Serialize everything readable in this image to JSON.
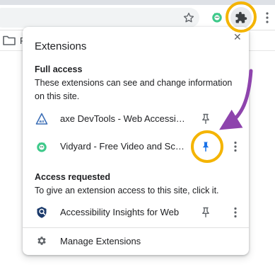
{
  "bookmarks_bar": {
    "folder_label": "F"
  },
  "popup": {
    "title": "Extensions",
    "full_access": {
      "heading": "Full access",
      "description": "These extensions can see and change information on this site.",
      "items": [
        {
          "name": "axe DevTools - Web Accessibility Testing",
          "icon": "axe-icon",
          "pinned": false
        },
        {
          "name": "Vidyard - Free Video and Screen Recorder",
          "icon": "vidyard-icon",
          "pinned": true
        }
      ]
    },
    "access_requested": {
      "heading": "Access requested",
      "description": "To give an extension access to this site, click it.",
      "items": [
        {
          "name": "Accessibility Insights for Web",
          "icon": "accessibility-insights-icon",
          "pinned": false
        }
      ]
    },
    "manage_label": "Manage Extensions"
  },
  "colors": {
    "highlight_ring": "#f4b400",
    "annotation_arrow": "#8e44ad",
    "pin_active": "#1a73e8",
    "pin_inactive": "#5f6368"
  },
  "icons": [
    "star-icon",
    "vidyard-toolbar-icon",
    "puzzle-icon",
    "menu-dots-icon",
    "folder-icon",
    "close-icon",
    "pin-icon",
    "more-vert-icon",
    "gear-icon"
  ]
}
